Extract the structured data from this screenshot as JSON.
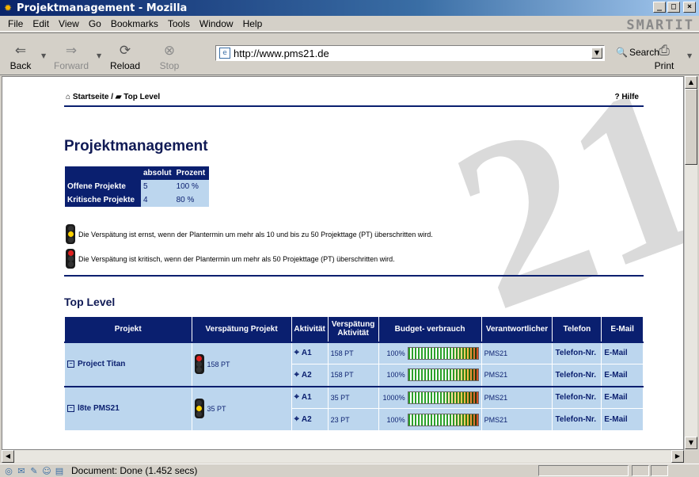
{
  "window": {
    "title": "Projektmanagement - Mozilla",
    "brand": "SMARTIT"
  },
  "menu": [
    "File",
    "Edit",
    "View",
    "Go",
    "Bookmarks",
    "Tools",
    "Window",
    "Help"
  ],
  "toolbar": {
    "back": "Back",
    "forward": "Forward",
    "reload": "Reload",
    "stop": "Stop",
    "url": "http://www.pms21.de",
    "search": "Search",
    "print": "Print"
  },
  "status": {
    "text": "Document: Done (1.452 secs)"
  },
  "page": {
    "breadcrumb_home": "Startseite",
    "breadcrumb_sep": "/",
    "breadcrumb_current": "Top Level",
    "help": "? Hilfe",
    "title": "Projektmanagement",
    "summary": {
      "headers": [
        "absolut",
        "Prozent"
      ],
      "rows": [
        {
          "label": "Offene Projekte",
          "absolut": "5",
          "prozent": "100 %"
        },
        {
          "label": "Kritische Projekte",
          "absolut": "4",
          "prozent": "80 %"
        }
      ]
    },
    "note_yellow": "Die Verspätung ist ernst, wenn der Plantermin um mehr als 10 und bis zu 50 Projekttage (PT) überschritten wird.",
    "note_red": "Die Verspätung ist kritisch, wenn der Plantermin um mehr als 50 Projekttage (PT) überschritten wird.",
    "section_title": "Top Level",
    "table": {
      "headers": [
        "Projekt",
        "Verspätung Projekt",
        "Aktivität",
        "Verspätung Aktivität",
        "Budget- verbrauch",
        "Verantwortlicher",
        "Telefon",
        "E-Mail"
      ],
      "projects": [
        {
          "name": "Project Titan",
          "light": "red",
          "delay": "158 PT",
          "activities": [
            {
              "id": "A1",
              "delay": "158 PT",
              "budget": "100%",
              "budget_fraction": 1.0,
              "owner": "PMS21",
              "phone": "Telefon-Nr.",
              "email": "E-Mail"
            },
            {
              "id": "A2",
              "delay": "158 PT",
              "budget": "100%",
              "budget_fraction": 1.0,
              "owner": "PMS21",
              "phone": "Telefon-Nr.",
              "email": "E-Mail"
            }
          ]
        },
        {
          "name": "l8te PMS21",
          "light": "yellow",
          "delay": "35 PT",
          "activities": [
            {
              "id": "A1",
              "delay": "35 PT",
              "budget": "1000%",
              "budget_fraction": 1.0,
              "owner": "PMS21",
              "phone": "Telefon-Nr.",
              "email": "E-Mail"
            },
            {
              "id": "A2",
              "delay": "23 PT",
              "budget": "100%",
              "budget_fraction": 1.0,
              "owner": "PMS21",
              "phone": "Telefon-Nr.",
              "email": "E-Mail"
            }
          ]
        }
      ]
    }
  },
  "colors": {
    "navy": "#0a1f6f",
    "cell": "#bcd6ee",
    "light_red": "#e02020",
    "light_yellow": "#ffd200"
  }
}
